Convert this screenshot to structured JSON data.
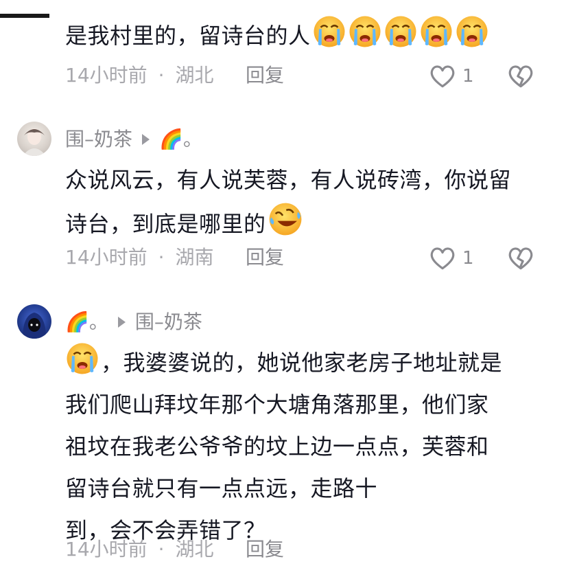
{
  "colors": {
    "text": "#161823",
    "meta": "#a8a8ad",
    "icon": "#8a8a8f"
  },
  "comments": [
    {
      "text_lines": [
        "是我村里的，留诗台的人"
      ],
      "emoji_count": 5,
      "emoji": "crying-emoji",
      "time": "14小时前",
      "sep": "·",
      "location": "湖北",
      "reply_label": "回复",
      "likes": "1"
    },
    {
      "username": "围–奶茶",
      "reply_to": "🌈。",
      "text_lines": [
        "众说风云，有人说芙蓉，有人说砖湾，你说留",
        "诗台，到底是哪里的"
      ],
      "emoji": "laughing-crying-emoji",
      "time": "14小时前",
      "sep": "·",
      "location": "湖南",
      "reply_label": "回复",
      "likes": "1"
    },
    {
      "username": "🌈。",
      "reply_to": "围–奶茶",
      "text_lines": [
        "，我婆婆说的，她说他家老房子地址就是",
        "我们爬山拜坟年那个大塘角落那里，他们家",
        "祖坟在我老公爷爷的坟上边一点点，芙蓉和",
        "留诗台就只有一点点远，走路十",
        "到，会不会弄错了？"
      ],
      "emoji": "crying-emoji",
      "time": "14小时前",
      "sep": "·",
      "location": "湖北",
      "reply_label": "回复"
    }
  ]
}
